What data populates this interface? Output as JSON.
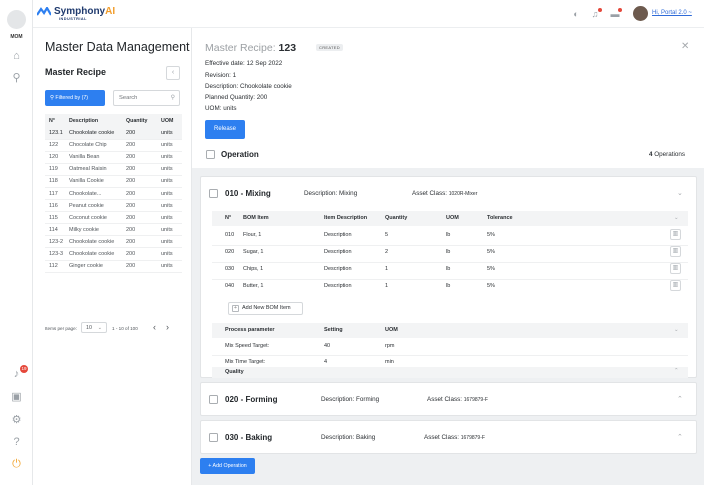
{
  "rail": {
    "module": "MOM",
    "notification_count": "19"
  },
  "header": {
    "brand": "Symphony",
    "brand_suffix": "AI",
    "brand_sub": "INDUSTRIAL",
    "user": "Hi, Portal 2.0 ~"
  },
  "left": {
    "page_title": "Master Data Management",
    "section_title": "Master Recipe",
    "filter_label": "Filtered by (7)",
    "search_placeholder": "Search",
    "columns": [
      "N°",
      "Description",
      "Quantity",
      "UOM"
    ],
    "rows": [
      {
        "no": "123.1",
        "desc": "Chookolate cookie",
        "qty": "200",
        "uom": "units"
      },
      {
        "no": "122",
        "desc": "Chocolate Chip",
        "qty": "200",
        "uom": "units"
      },
      {
        "no": "120",
        "desc": "Vanilla Bean",
        "qty": "200",
        "uom": "units"
      },
      {
        "no": "119",
        "desc": "Oatmeal Raisin",
        "qty": "200",
        "uom": "units"
      },
      {
        "no": "118",
        "desc": "Vanilla Cookie",
        "qty": "200",
        "uom": "units"
      },
      {
        "no": "117",
        "desc": "Chookolate...",
        "qty": "200",
        "uom": "units"
      },
      {
        "no": "116",
        "desc": "Peanut cookie",
        "qty": "200",
        "uom": "units"
      },
      {
        "no": "115",
        "desc": "Coconut cookie",
        "qty": "200",
        "uom": "units"
      },
      {
        "no": "114",
        "desc": "Milky cookie",
        "qty": "200",
        "uom": "units"
      },
      {
        "no": "123-2",
        "desc": "Chookolate cookie",
        "qty": "200",
        "uom": "units"
      },
      {
        "no": "123-3",
        "desc": "Chookolate cookie",
        "qty": "200",
        "uom": "units"
      },
      {
        "no": "112",
        "desc": "Ginger cookie",
        "qty": "200",
        "uom": "units"
      }
    ],
    "pager": {
      "items_per_page_label": "Items per page:",
      "items_per_page": "10",
      "range": "1 - 10 of 100"
    }
  },
  "recipe": {
    "title_prefix": "Master Recipe: ",
    "id": "123",
    "status": "CREATED",
    "effective_date": "Effective date:  12 Sep 2022",
    "revision": "Revision:   1",
    "description": "Description:   Chookolate cookie",
    "planned_qty": "Planned Quantity:   200",
    "uom": "UOM:   units",
    "release_label": "Release",
    "operation_label": "Operation",
    "operation_count": "4",
    "operation_count_suffix": " Operations",
    "add_operation_label": "+ Add Operation"
  },
  "operations": [
    {
      "name": "010 - Mixing",
      "description": "Description: Mixing",
      "asset_label": "Asset Class: ",
      "asset_value": "1020R-Mixer"
    },
    {
      "name": "020 - Forming",
      "description": "Description: Forming",
      "asset_label": "Asset Class: ",
      "asset_value": "1679879-F"
    },
    {
      "name": "030 - Baking",
      "description": "Description: Baking",
      "asset_label": "Asset Class: ",
      "asset_value": "1679879-F"
    }
  ],
  "bom": {
    "columns": [
      "N°",
      "BOM Item",
      "Item Description",
      "Quantity",
      "UOM",
      "Tolerance"
    ],
    "rows": [
      {
        "no": "010",
        "item": "Flour, 1",
        "desc": "Description",
        "qty": "5",
        "uom": "lb",
        "tol": "5%"
      },
      {
        "no": "020",
        "item": "Sugar, 1",
        "desc": "Description",
        "qty": "2",
        "uom": "lb",
        "tol": "5%"
      },
      {
        "no": "030",
        "item": "Chips, 1",
        "desc": "Description",
        "qty": "1",
        "uom": "lb",
        "tol": "5%"
      },
      {
        "no": "040",
        "item": "Butter, 1",
        "desc": "Description",
        "qty": "1",
        "uom": "lb",
        "tol": "5%"
      }
    ],
    "add_label": "Add New BOM Item"
  },
  "params": {
    "columns": [
      "Process parameter",
      "Setting",
      "UOM"
    ],
    "rows": [
      {
        "name": "Mix Speed Target:",
        "setting": "40",
        "uom": "rpm"
      },
      {
        "name": "Mix Time Target:",
        "setting": "4",
        "uom": "min"
      }
    ],
    "quality_label": "Quality"
  },
  "colors": {
    "primary": "#2d7ff0",
    "brand": "#1f3a6e",
    "brand_accent": "#f29d2b",
    "alert": "#e5483b"
  }
}
